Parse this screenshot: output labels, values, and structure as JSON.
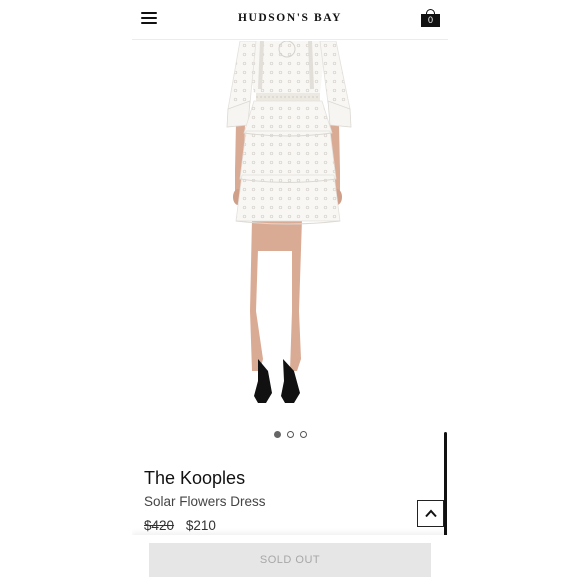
{
  "header": {
    "logo": "HUDSON'S BAY",
    "cart_count": "0"
  },
  "gallery": {
    "image_count": 3,
    "active_index": 0
  },
  "product": {
    "brand": "The Kooples",
    "name": "Solar Flowers Dress",
    "original_price": "$420",
    "sale_price": "$210"
  },
  "actions": {
    "sold_out_label": "SOLD OUT"
  },
  "colors": {
    "dress": "#f7f6f3",
    "skin": "#d9ab95",
    "shoes": "#111111",
    "button_bg": "#e6e6e6"
  }
}
